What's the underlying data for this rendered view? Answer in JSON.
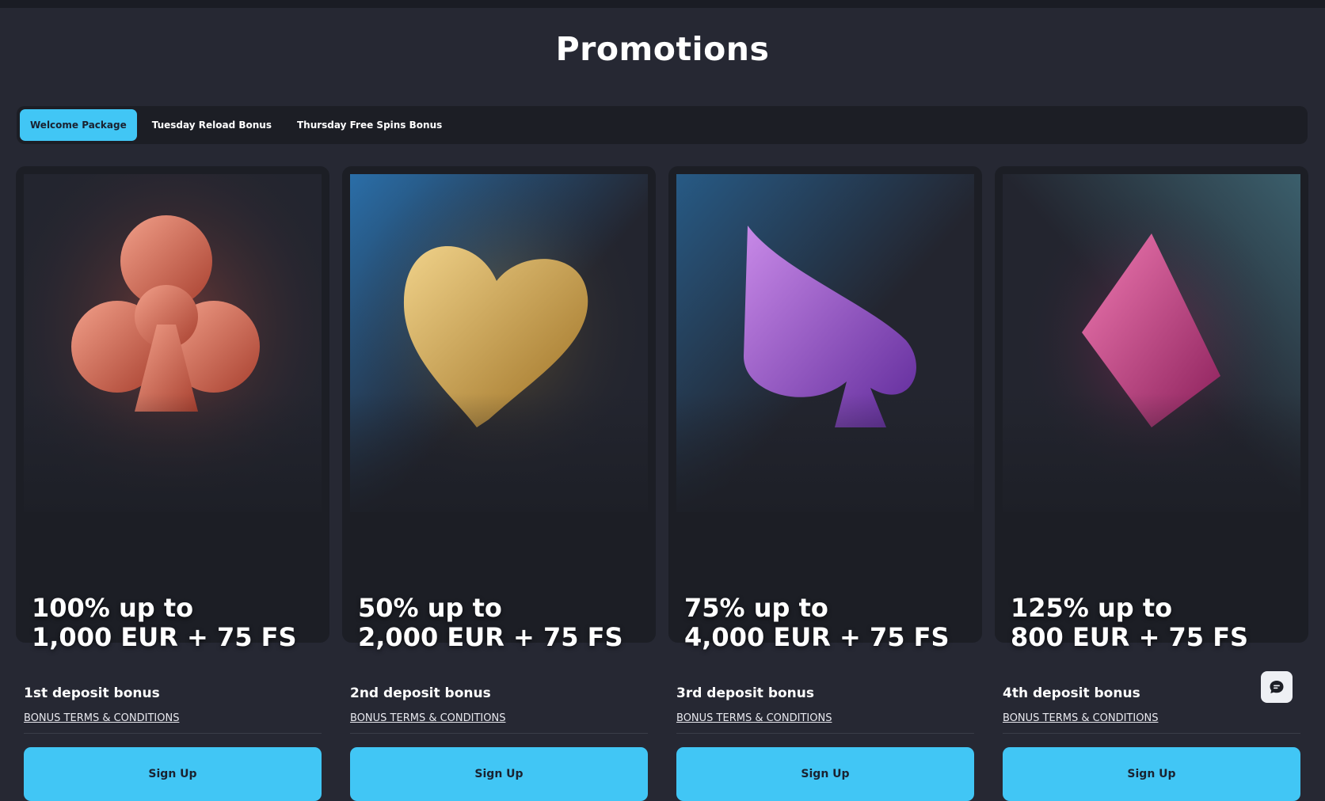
{
  "page": {
    "title": "Promotions"
  },
  "tabs": [
    {
      "label": "Welcome Package",
      "active": true
    },
    {
      "label": "Tuesday Reload Bonus",
      "active": false
    },
    {
      "label": "Thursday Free Spins Bonus",
      "active": false
    }
  ],
  "cards": [
    {
      "line1": "100% up to",
      "line2": "1,000 EUR + 75 FS",
      "deposit": "1st deposit bonus",
      "terms": "BONUS TERMS & CONDITIONS",
      "button": "Sign Up",
      "icon": "club-icon",
      "color": "#d9735e"
    },
    {
      "line1": "50% up to",
      "line2": "2,000 EUR + 75 FS",
      "deposit": "2nd deposit bonus",
      "terms": "BONUS TERMS & CONDITIONS",
      "button": "Sign Up",
      "icon": "heart-icon",
      "color": "#d9a94a"
    },
    {
      "line1": "75% up to",
      "line2": "4,000 EUR + 75 FS",
      "deposit": "3rd deposit bonus",
      "terms": "BONUS TERMS & CONDITIONS",
      "button": "Sign Up",
      "icon": "spade-icon",
      "color": "#9b4fd0"
    },
    {
      "line1": "125% up to",
      "line2": "800 EUR + 75 FS",
      "deposit": "4th deposit bonus",
      "terms": "BONUS TERMS & CONDITIONS",
      "button": "Sign Up",
      "icon": "diamond-icon",
      "color": "#d8458a"
    }
  ],
  "chat": {
    "icon": "chat-icon"
  },
  "colors": {
    "accent": "#41c6f5",
    "background": "#262833",
    "card": "#1c1e25"
  }
}
